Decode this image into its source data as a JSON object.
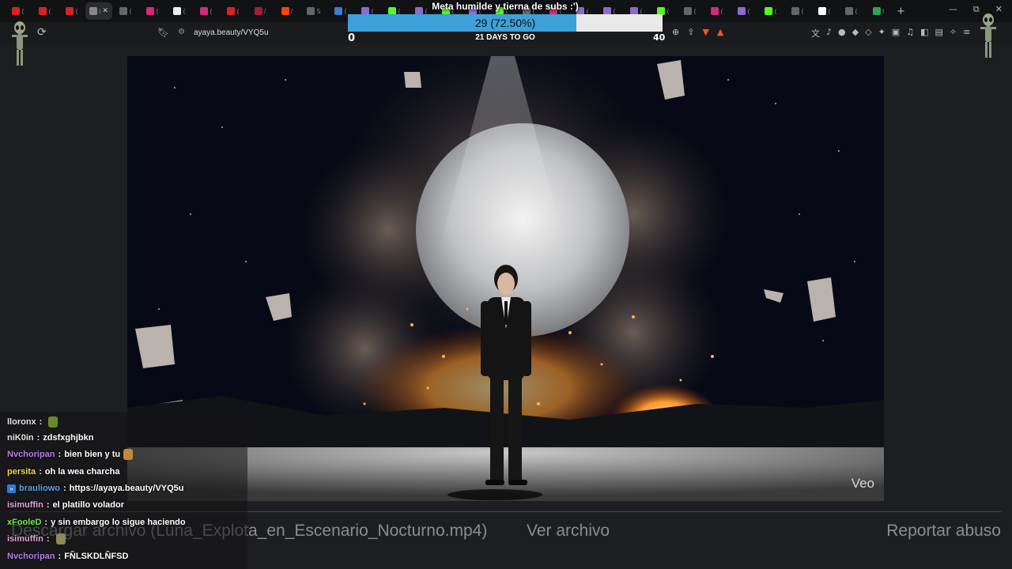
{
  "browser": {
    "tabs": [
      {
        "icon": "youtube-icon",
        "color": "#e02020",
        "label": "("
      },
      {
        "icon": "youtube-icon",
        "color": "#e02020",
        "label": "("
      },
      {
        "icon": "youtube-icon",
        "color": "#e02020",
        "label": "("
      },
      {
        "icon": "tab-icon",
        "color": "#888888",
        "label": "I",
        "active": true,
        "close": "✕"
      },
      {
        "icon": "generic-icon",
        "color": "#666666",
        "label": "("
      },
      {
        "icon": "instagram-icon",
        "color": "#d62976",
        "label": "("
      },
      {
        "icon": "tiktok-icon",
        "color": "#eeeeee",
        "label": "("
      },
      {
        "icon": "instagram-icon",
        "color": "#d62976",
        "label": "("
      },
      {
        "icon": "youtube-icon",
        "color": "#e02020",
        "label": "("
      },
      {
        "icon": "generic-icon",
        "color": "#a0203a",
        "label": "/"
      },
      {
        "icon": "reddit-icon",
        "color": "#ff4500",
        "label": "/"
      },
      {
        "icon": "generic-icon",
        "color": "#666666",
        "label": "S"
      },
      {
        "icon": "pixiv-icon",
        "color": "#3a7bd5",
        "label": "("
      },
      {
        "icon": "feather-icon",
        "color": "#8a6bd1",
        "label": "("
      },
      {
        "icon": "kick-icon",
        "color": "#53fc18",
        "label": "("
      },
      {
        "icon": "feather-icon",
        "color": "#8a6bd1",
        "label": "("
      },
      {
        "icon": "kick-icon",
        "color": "#53fc18",
        "label": "("
      },
      {
        "icon": "feather-icon",
        "color": "#8a6bd1",
        "label": "("
      },
      {
        "icon": "kick-icon",
        "color": "#53fc18",
        "label": "("
      },
      {
        "icon": "generic-icon",
        "color": "#666666",
        "label": "("
      },
      {
        "icon": "instagram-icon",
        "color": "#d62976",
        "label": "("
      },
      {
        "icon": "feather-icon",
        "color": "#8a6bd1",
        "label": "("
      },
      {
        "icon": "feather-icon",
        "color": "#8a6bd1",
        "label": "("
      },
      {
        "icon": "feather-icon",
        "color": "#8a6bd1",
        "label": "("
      },
      {
        "icon": "kick-icon",
        "color": "#53fc18",
        "label": "("
      },
      {
        "icon": "generic-icon",
        "color": "#666666",
        "label": "("
      },
      {
        "icon": "instagram-icon",
        "color": "#d62976",
        "label": "("
      },
      {
        "icon": "feather-icon",
        "color": "#8a6bd1",
        "label": "("
      },
      {
        "icon": "kick-icon",
        "color": "#53fc18",
        "label": "("
      },
      {
        "icon": "generic-icon",
        "color": "#666666",
        "label": "("
      },
      {
        "icon": "google-icon",
        "color": "#ffffff",
        "label": "("
      },
      {
        "icon": "generic-icon",
        "color": "#666666",
        "label": "("
      },
      {
        "icon": "sheets-icon",
        "color": "#2aa55b",
        "label": "I"
      }
    ],
    "new_tab": "+",
    "minimize": "—",
    "restore": "⧉",
    "close": "✕",
    "url": "ayaya.beauty/VYQ5u"
  },
  "subgoal": {
    "title": "Meta humilde y tierna de subs :')",
    "progress_text": "29 (72.50%)",
    "current": 29,
    "target": 40,
    "fraction": 0.725,
    "days_left": "21 DAYS TO GO",
    "min_label": "0",
    "max_label": "40",
    "fill_color": "#3f9fd9"
  },
  "video": {
    "watermark": "Veo"
  },
  "footer": {
    "download": "Descargar archivo (Luna_Explota_en_Escenario_Nocturno.mp4)",
    "view": "Ver archivo",
    "report": "Reportar abuso"
  },
  "chat": {
    "messages": [
      {
        "user": "lloronx",
        "color": "#e6e6e6",
        "text": "",
        "emote": "#6a8a2a"
      },
      {
        "user": "niK0in",
        "color": "#e6e6e6",
        "text": "zdsfxghjbkn"
      },
      {
        "user": "Nvchoripan",
        "color": "#b57ee8",
        "text": "bien bien y tu",
        "emote": "#c08a3a"
      },
      {
        "user": "persita",
        "color": "#f2d64b",
        "text": "oh la wea charcha"
      },
      {
        "user": "brauliowo",
        "color": "#5aa0e6",
        "text": "https://ayaya.beauty/VYQ5u",
        "badge": "»"
      },
      {
        "user": "isimuffin",
        "color": "#e6a0d8",
        "text": "el platillo volador"
      },
      {
        "user": "xFooleD",
        "color": "#7ee84a",
        "text": "y sin embargo lo sigue haciendo"
      },
      {
        "user": "isimuffin",
        "color": "#e6a0d8",
        "text": "",
        "emote": "#8a8a5a"
      },
      {
        "user": "Nvchoripan",
        "color": "#b57ee8",
        "text": "FÑLSKDLÑFSD"
      }
    ]
  }
}
